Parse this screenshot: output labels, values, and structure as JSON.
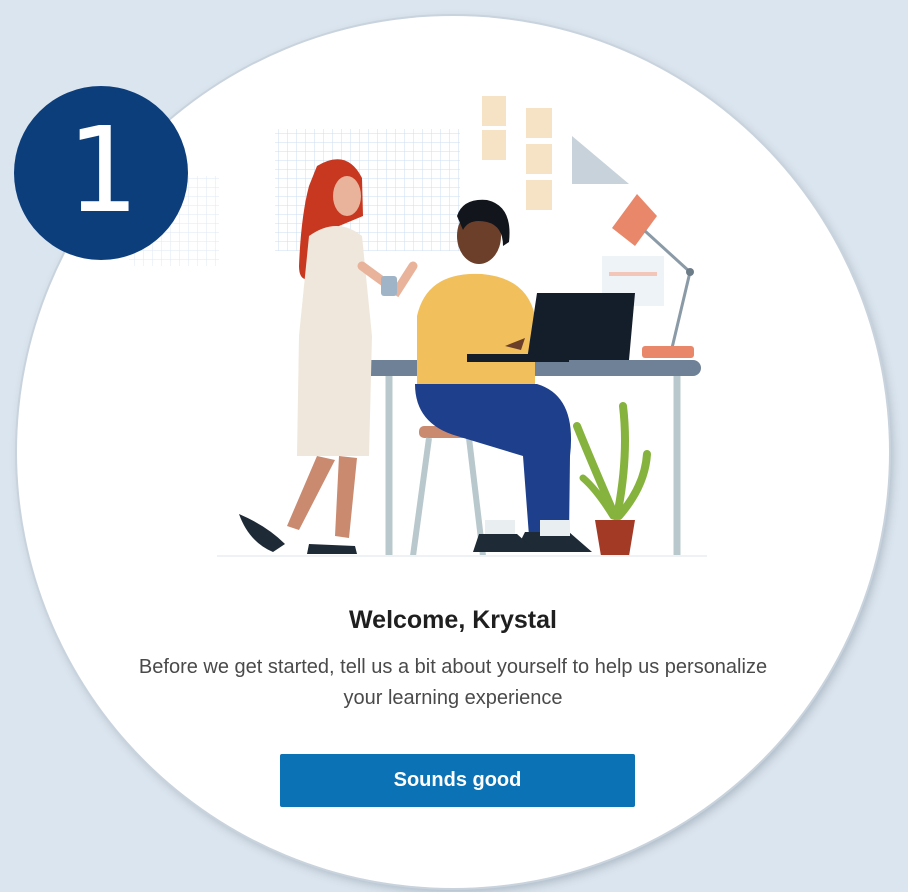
{
  "step_badge": {
    "number": "1",
    "color": "#0d3e7c"
  },
  "welcome": {
    "title": "Welcome, Krystal",
    "subtitle": "Before we get started, tell us a bit about yourself to help us personalize your learning experience"
  },
  "primary_button": {
    "label": "Sounds good",
    "color": "#0a72b5"
  },
  "illustration": {
    "icon": "two-people-at-desk-illustration"
  }
}
